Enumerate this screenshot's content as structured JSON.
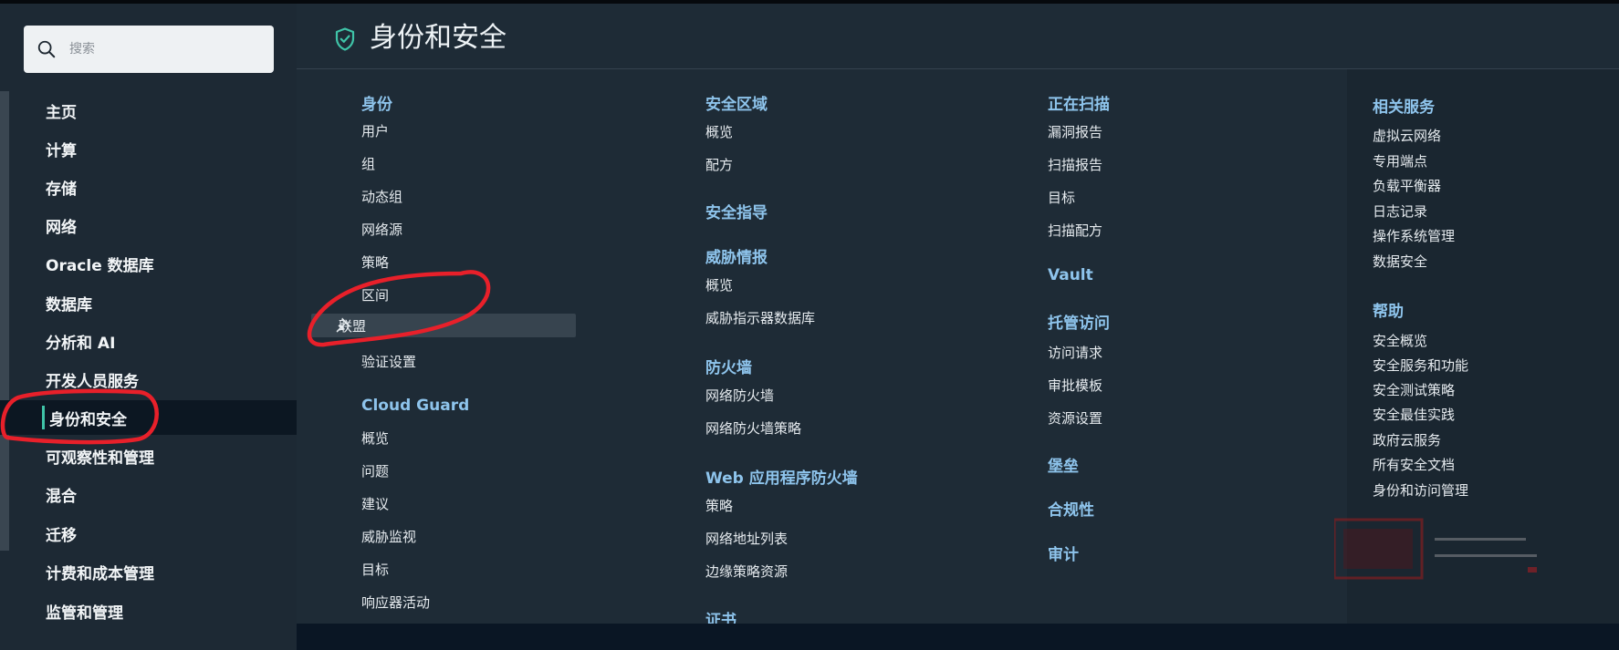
{
  "search": {
    "placeholder": "搜索"
  },
  "nav": {
    "items": [
      {
        "label": "主页"
      },
      {
        "label": "计算"
      },
      {
        "label": "存储"
      },
      {
        "label": "网络"
      },
      {
        "label": "Oracle 数据库"
      },
      {
        "label": "数据库"
      },
      {
        "label": "分析和 AI"
      },
      {
        "label": "开发人员服务"
      },
      {
        "label": "身份和安全",
        "active": true
      },
      {
        "label": "可观察性和管理"
      },
      {
        "label": "混合"
      },
      {
        "label": "迁移"
      },
      {
        "label": "计费和成本管理"
      },
      {
        "label": "监管和管理"
      }
    ]
  },
  "panel": {
    "title": "身份和安全",
    "icon": "shield-check-icon",
    "accent_color": "#3fc4a8",
    "section_title_color": "#8ec4ec"
  },
  "columns": {
    "col1": {
      "identity": {
        "title": "身份",
        "links": [
          "用户",
          "组",
          "动态组",
          "网络源",
          "策略",
          "区间",
          "联盟",
          "验证设置"
        ]
      },
      "cloud_guard": {
        "title": "Cloud Guard",
        "links": [
          "概览",
          "问题",
          "建议",
          "威胁监视",
          "目标",
          "响应器活动"
        ]
      }
    },
    "col2": {
      "security_zones": {
        "title": "安全区域",
        "links": [
          "概览",
          "配方"
        ]
      },
      "security_advisor": {
        "title": "安全指导"
      },
      "threat_intel": {
        "title": "威胁情报",
        "links": [
          "概览",
          "威胁指示器数据库"
        ]
      },
      "firewall": {
        "title": "防火墙",
        "links": [
          "网络防火墙",
          "网络防火墙策略"
        ]
      },
      "waf": {
        "title": "Web 应用程序防火墙",
        "links": [
          "策略",
          "网络地址列表",
          "边缘策略资源"
        ]
      },
      "certificates": {
        "title": "证书"
      }
    },
    "col3": {
      "scanning": {
        "title": "正在扫描",
        "links": [
          "漏洞报告",
          "扫描报告",
          "目标",
          "扫描配方"
        ]
      },
      "vault": {
        "title": "Vault"
      },
      "managed_access": {
        "title": "托管访问",
        "links": [
          "访问请求",
          "审批模板",
          "资源设置"
        ]
      },
      "bastion": {
        "title": "堡垒"
      },
      "compliance": {
        "title": "合规性"
      },
      "audit": {
        "title": "审计"
      }
    },
    "col4": {
      "related": {
        "title": "相关服务",
        "links": [
          "虚拟云网络",
          "专用端点",
          "负载平衡器",
          "日志记录",
          "操作系统管理",
          "数据安全"
        ]
      },
      "help": {
        "title": "帮助",
        "links": [
          "安全概览",
          "安全服务和功能",
          "安全测试策略",
          "安全最佳实践",
          "政府云服务",
          "所有安全文档",
          "身份和访问管理"
        ]
      }
    }
  },
  "annotation": {
    "color": "#e8202a"
  }
}
